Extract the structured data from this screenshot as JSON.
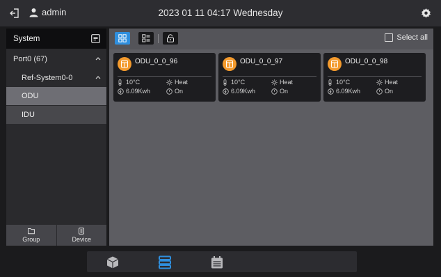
{
  "header": {
    "username": "admin",
    "datetime": "2023 01 11 04:17 Wednesday",
    "icons": {
      "exit": "exit-icon",
      "user": "user-icon",
      "settings": "gear-icon"
    }
  },
  "sidebar": {
    "title": "System",
    "tree": [
      {
        "label": "Port0 (67)",
        "expanded": true
      },
      {
        "label": "Ref-System0-0",
        "expanded": true
      }
    ],
    "items": [
      {
        "label": "ODU",
        "selected": true
      },
      {
        "label": "IDU",
        "selected": false
      }
    ],
    "bottom_buttons": [
      {
        "label": "Group",
        "icon": "folder-icon"
      },
      {
        "label": "Device",
        "icon": "device-icon"
      }
    ]
  },
  "toolbar": {
    "view_modes": [
      "grid-view-icon",
      "list-view-icon",
      "lock-icon"
    ],
    "active_view": "grid",
    "select_all_label": "Select all",
    "select_all_checked": false
  },
  "cards": [
    {
      "name": "ODU_0_0_96",
      "temperature": "10°C",
      "mode": "Heat",
      "energy": "6.09Kwh",
      "state": "On"
    },
    {
      "name": "ODU_0_0_97",
      "temperature": "10°C",
      "mode": "Heat",
      "energy": "6.09Kwh",
      "state": "On"
    },
    {
      "name": "ODU_0_0_98",
      "temperature": "10°C",
      "mode": "Heat",
      "energy": "6.09Kwh",
      "state": "On"
    }
  ],
  "bottom_nav": {
    "items": [
      "device-box-icon",
      "device-list-icon",
      "calendar-icon"
    ],
    "active": "device-list-icon"
  },
  "colors": {
    "accent": "#2f8fde",
    "odu_badge": "#f39a2d",
    "selected_item": "#6e6e74"
  }
}
